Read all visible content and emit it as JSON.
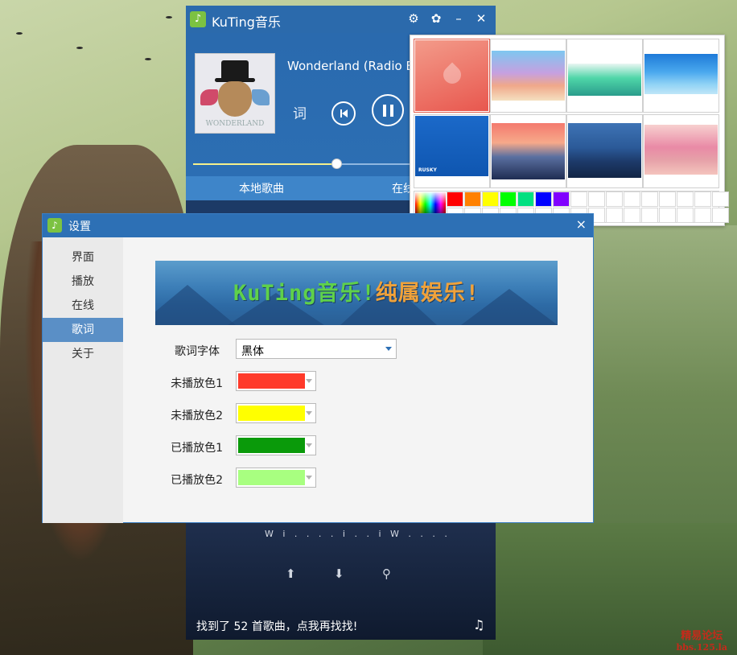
{
  "player": {
    "app_title": "KuTing音乐",
    "now_playing": {
      "title": "Wonderland (Radio E"
    },
    "album_art_text": "WONDERLAND",
    "lyric_button": "词",
    "progress_fraction": 0.48,
    "tabs": [
      "本地歌曲",
      "在线"
    ],
    "lyric_preview": "W i . . . . i . . i W . . . .",
    "status": "找到了 52 首歌曲，点我再找找!"
  },
  "skins": {
    "swatch_colors": [
      "#ff0000",
      "#ff8000",
      "#ffff00",
      "#00ff00",
      "#00e080",
      "#0000ff",
      "#8000ff",
      "#ffffff",
      "#ffffff",
      "#ffffff",
      "#ffffff",
      "#ffffff",
      "#ffffff",
      "#ffffff",
      "#ffffff",
      "#ffffff",
      "#ffffff",
      "#ffffff",
      "#ffffff",
      "#ffffff",
      "#ffffff",
      "#ffffff",
      "#ffffff",
      "#ffffff",
      "#ffffff",
      "#ffffff",
      "#ffffff",
      "#ffffff",
      "#ffffff",
      "#ffffff",
      "#ffffff",
      "#ffffff"
    ],
    "thumb5_label": "RUSKY"
  },
  "settings": {
    "title": "设置",
    "close": "×",
    "nav": [
      "界面",
      "播放",
      "在线",
      "歌词",
      "关于"
    ],
    "active_nav": "歌词",
    "banner": {
      "part1": "KuTing音乐!",
      "part2": "纯属娱乐!"
    },
    "font_label": "歌词字体",
    "font_value": "黑体",
    "colors": [
      {
        "label": "未播放色1",
        "color": "#ff3a2a"
      },
      {
        "label": "未播放色2",
        "color": "#ffff00"
      },
      {
        "label": "已播放色1",
        "color": "#0a9a0a"
      },
      {
        "label": "已播放色2",
        "color": "#a8ff80"
      }
    ]
  },
  "watermark": {
    "line1": "精易论坛",
    "line2": "bbs.125.la"
  }
}
